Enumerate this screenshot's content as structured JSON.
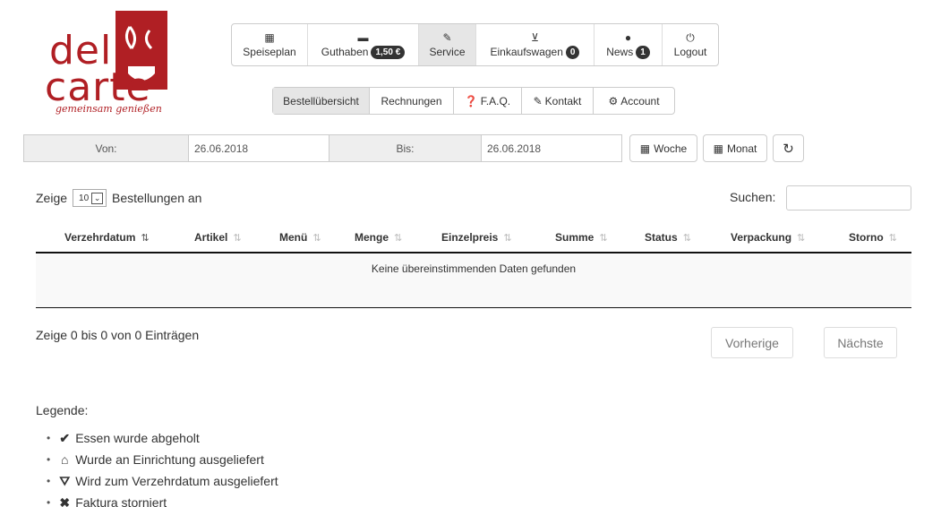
{
  "logo": {
    "line1": "deli",
    "line2": "carte",
    "slogan": "gemeinsam genießen"
  },
  "topnav": [
    {
      "label": "Speiseplan",
      "icon": "calendar-icon",
      "badge": ""
    },
    {
      "label": "Guthaben",
      "icon": "credit-card-icon",
      "badge": "1,50 €"
    },
    {
      "label": "Service",
      "icon": "pencil-icon",
      "badge": ""
    },
    {
      "label": "Einkaufswagen",
      "icon": "cart-icon",
      "badge": "0"
    },
    {
      "label": "News",
      "icon": "info-icon",
      "badge": "1"
    },
    {
      "label": "Logout",
      "icon": "power-icon",
      "badge": ""
    }
  ],
  "subnav": [
    {
      "label": "Bestellübersicht",
      "icon": ""
    },
    {
      "label": "Rechnungen",
      "icon": ""
    },
    {
      "label": "F.A.Q.",
      "icon": "question-icon"
    },
    {
      "label": "Kontakt",
      "icon": "pencil-icon"
    },
    {
      "label": "Account",
      "icon": "gear-icon"
    }
  ],
  "daterange": {
    "from_label": "Von:",
    "from_value": "26.06.2018",
    "to_label": "Bis:",
    "to_value": "26.06.2018",
    "week_label": "Woche",
    "month_label": "Monat"
  },
  "table_controls": {
    "show_prefix": "Zeige",
    "page_size": "10",
    "show_suffix": "Bestellungen an",
    "search_label": "Suchen:",
    "search_value": ""
  },
  "table": {
    "columns": [
      "Verzehrdatum",
      "Artikel",
      "Menü",
      "Menge",
      "Einzelpreis",
      "Summe",
      "Status",
      "Verpackung",
      "Storno"
    ],
    "empty_message": "Keine übereinstimmenden Daten gefunden"
  },
  "pagination": {
    "info": "Zeige 0 bis 0 von 0 Einträgen",
    "prev": "Vorherige",
    "next": "Nächste"
  },
  "legend": {
    "title": "Legende:",
    "items": [
      {
        "icon": "check-icon",
        "text": "Essen wurde abgeholt"
      },
      {
        "icon": "home-icon",
        "text": "Wurde an Einrichtung ausgeliefert"
      },
      {
        "icon": "road-icon",
        "text": "Wird zum Verzehrdatum ausgeliefert"
      },
      {
        "icon": "x-icon",
        "text": "Faktura storniert"
      }
    ]
  },
  "colors": {
    "brand": "#b01f24",
    "active_tab": "#e6e6e6"
  }
}
